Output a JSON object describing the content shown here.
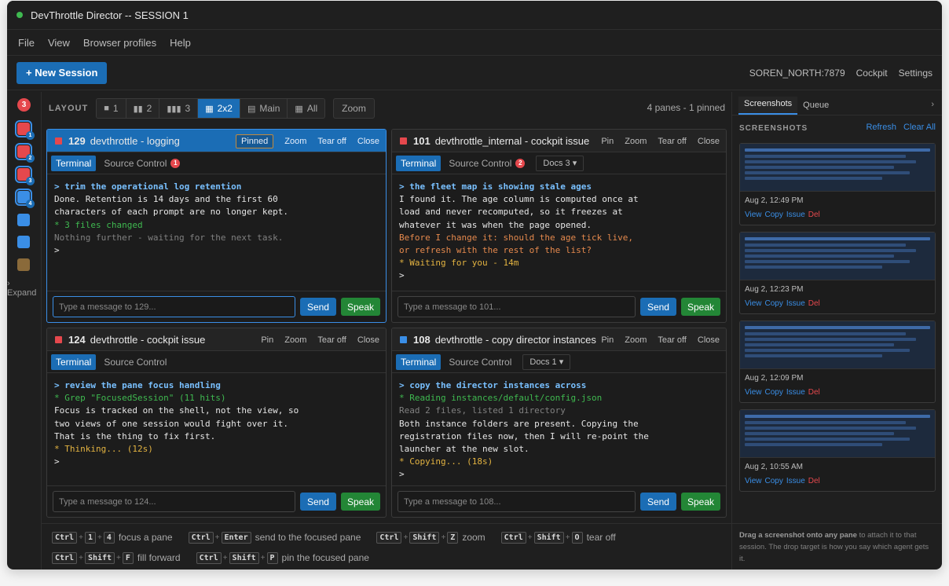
{
  "window": {
    "title": "DevThrottle Director -- SESSION 1",
    "status_color": "#3fb950"
  },
  "menu": [
    "File",
    "View",
    "Browser profiles",
    "Help"
  ],
  "toolbar": {
    "new_session": "+ New Session",
    "host": "SOREN_NORTH:7879",
    "cockpit": "Cockpit",
    "settings": "Settings"
  },
  "rail": {
    "badge": "3",
    "expand": "Expand",
    "numbers": [
      "1",
      "2",
      "3",
      "4"
    ]
  },
  "layout": {
    "label": "LAYOUT",
    "options": [
      {
        "label": "1",
        "icon": "single-pane-icon"
      },
      {
        "label": "2",
        "icon": "two-pane-icon"
      },
      {
        "label": "3",
        "icon": "three-pane-icon"
      },
      {
        "label": "2x2",
        "icon": "grid-icon",
        "active": true
      },
      {
        "label": "Main",
        "icon": "main-layout-icon"
      },
      {
        "label": "All",
        "icon": "all-grid-icon"
      }
    ],
    "zoom": "Zoom",
    "pane_count": "4 panes - 1 pinned"
  },
  "common": {
    "pin": "Pin",
    "pinned": "Pinned",
    "zoom": "Zoom",
    "tear_off": "Tear off",
    "close": "Close",
    "terminal": "Terminal",
    "source_control": "Source Control",
    "send": "Send",
    "speak": "Speak"
  },
  "panes": [
    {
      "id": "129",
      "name": "devthrottle - logging",
      "color": "#e5484d",
      "badge": "1",
      "docs": "",
      "placeholder": "Type a message to 129...",
      "lines": [
        {
          "t": "> trim the operational log retention",
          "c": "cmd"
        },
        {
          "t": "Done. Retention is 14 days and the first 60",
          "c": "norm"
        },
        {
          "t": "characters of each prompt are no longer kept.",
          "c": "norm"
        },
        {
          "t": "* 3 files changed",
          "c": "green"
        },
        {
          "t": "Nothing further - waiting for the next task.",
          "c": "dim"
        },
        {
          "t": ">",
          "c": "norm"
        }
      ]
    },
    {
      "id": "101",
      "name": "devthrottle_internal - cockpit issue",
      "color": "#e5484d",
      "badge": "2",
      "docs": "Docs 3",
      "placeholder": "Type a message to 101...",
      "lines": [
        {
          "t": "> the fleet map is showing stale ages",
          "c": "cmd"
        },
        {
          "t": "I found it. The age column is computed once at",
          "c": "norm"
        },
        {
          "t": "load and never recomputed, so it freezes at",
          "c": "norm"
        },
        {
          "t": "whatever it was when the page opened.",
          "c": "norm"
        },
        {
          "t": "Before I change it: should the age tick live,",
          "c": "orange"
        },
        {
          "t": "or refresh with the rest of the list?",
          "c": "orange"
        },
        {
          "t": "* Waiting for you - 14m",
          "c": "yellow"
        },
        {
          "t": ">",
          "c": "norm"
        }
      ]
    },
    {
      "id": "124",
      "name": "devthrottle - cockpit issue",
      "color": "#e5484d",
      "badge": "",
      "docs": "",
      "placeholder": "Type a message to 124...",
      "lines": [
        {
          "t": "> review the pane focus handling",
          "c": "cmd"
        },
        {
          "t": "* Grep \"FocusedSession\" (11 hits)",
          "c": "green"
        },
        {
          "t": "Focus is tracked on the shell, not the view, so",
          "c": "norm"
        },
        {
          "t": "two views of one session would fight over it.",
          "c": "norm"
        },
        {
          "t": "That is the thing to fix first.",
          "c": "norm"
        },
        {
          "t": "* Thinking... (12s)",
          "c": "yellow"
        },
        {
          "t": ">",
          "c": "norm"
        }
      ]
    },
    {
      "id": "108",
      "name": "devthrottle - copy director instances",
      "color": "#3a8ee6",
      "badge": "",
      "docs": "Docs 1",
      "placeholder": "Type a message to 108...",
      "lines": [
        {
          "t": "> copy the director instances across",
          "c": "cmd"
        },
        {
          "t": "* Reading instances/default/config.json",
          "c": "green"
        },
        {
          "t": "Read 2 files, listed 1 directory",
          "c": "dim"
        },
        {
          "t": "Both instance folders are present. Copying the",
          "c": "norm"
        },
        {
          "t": "registration files now, then I will re-point the",
          "c": "norm"
        },
        {
          "t": "launcher at the new slot.",
          "c": "norm"
        },
        {
          "t": "* Copying... (18s)",
          "c": "yellow"
        },
        {
          "t": ">",
          "c": "norm"
        }
      ]
    }
  ],
  "shortcuts": {
    "row1": [
      {
        "keys": [
          "Ctrl",
          "1",
          "4"
        ],
        "desc": "focus a pane"
      },
      {
        "keys": [
          "Ctrl",
          "Enter"
        ],
        "desc": "send to the focused pane"
      },
      {
        "keys": [
          "Ctrl",
          "Shift",
          "Z"
        ],
        "desc": "zoom"
      },
      {
        "keys": [
          "Ctrl",
          "Shift",
          "O"
        ],
        "desc": "tear off"
      }
    ],
    "row2": [
      {
        "keys": [
          "Ctrl",
          "Shift",
          "F"
        ],
        "desc": "fill forward"
      },
      {
        "keys": [
          "Ctrl",
          "Shift",
          "P"
        ],
        "desc": "pin the focused pane"
      }
    ]
  },
  "right_panel": {
    "tabs": [
      "Screenshots",
      "Queue"
    ],
    "section_title": "SCREENSHOTS",
    "refresh": "Refresh",
    "clear_all": "Clear All",
    "shots": [
      {
        "date": "Aug 2, 12:49 PM"
      },
      {
        "date": "Aug 2, 12:23 PM"
      },
      {
        "date": "Aug 2, 12:09 PM"
      },
      {
        "date": "Aug 2, 10:55 AM"
      }
    ],
    "shot_actions": {
      "view": "View",
      "copy": "Copy",
      "issue": "Issue",
      "del": "Del"
    },
    "footer_bold": "Drag a screenshot onto any pane",
    "footer_rest": " to attach it to that session. The drop target is how you say which agent gets it."
  }
}
